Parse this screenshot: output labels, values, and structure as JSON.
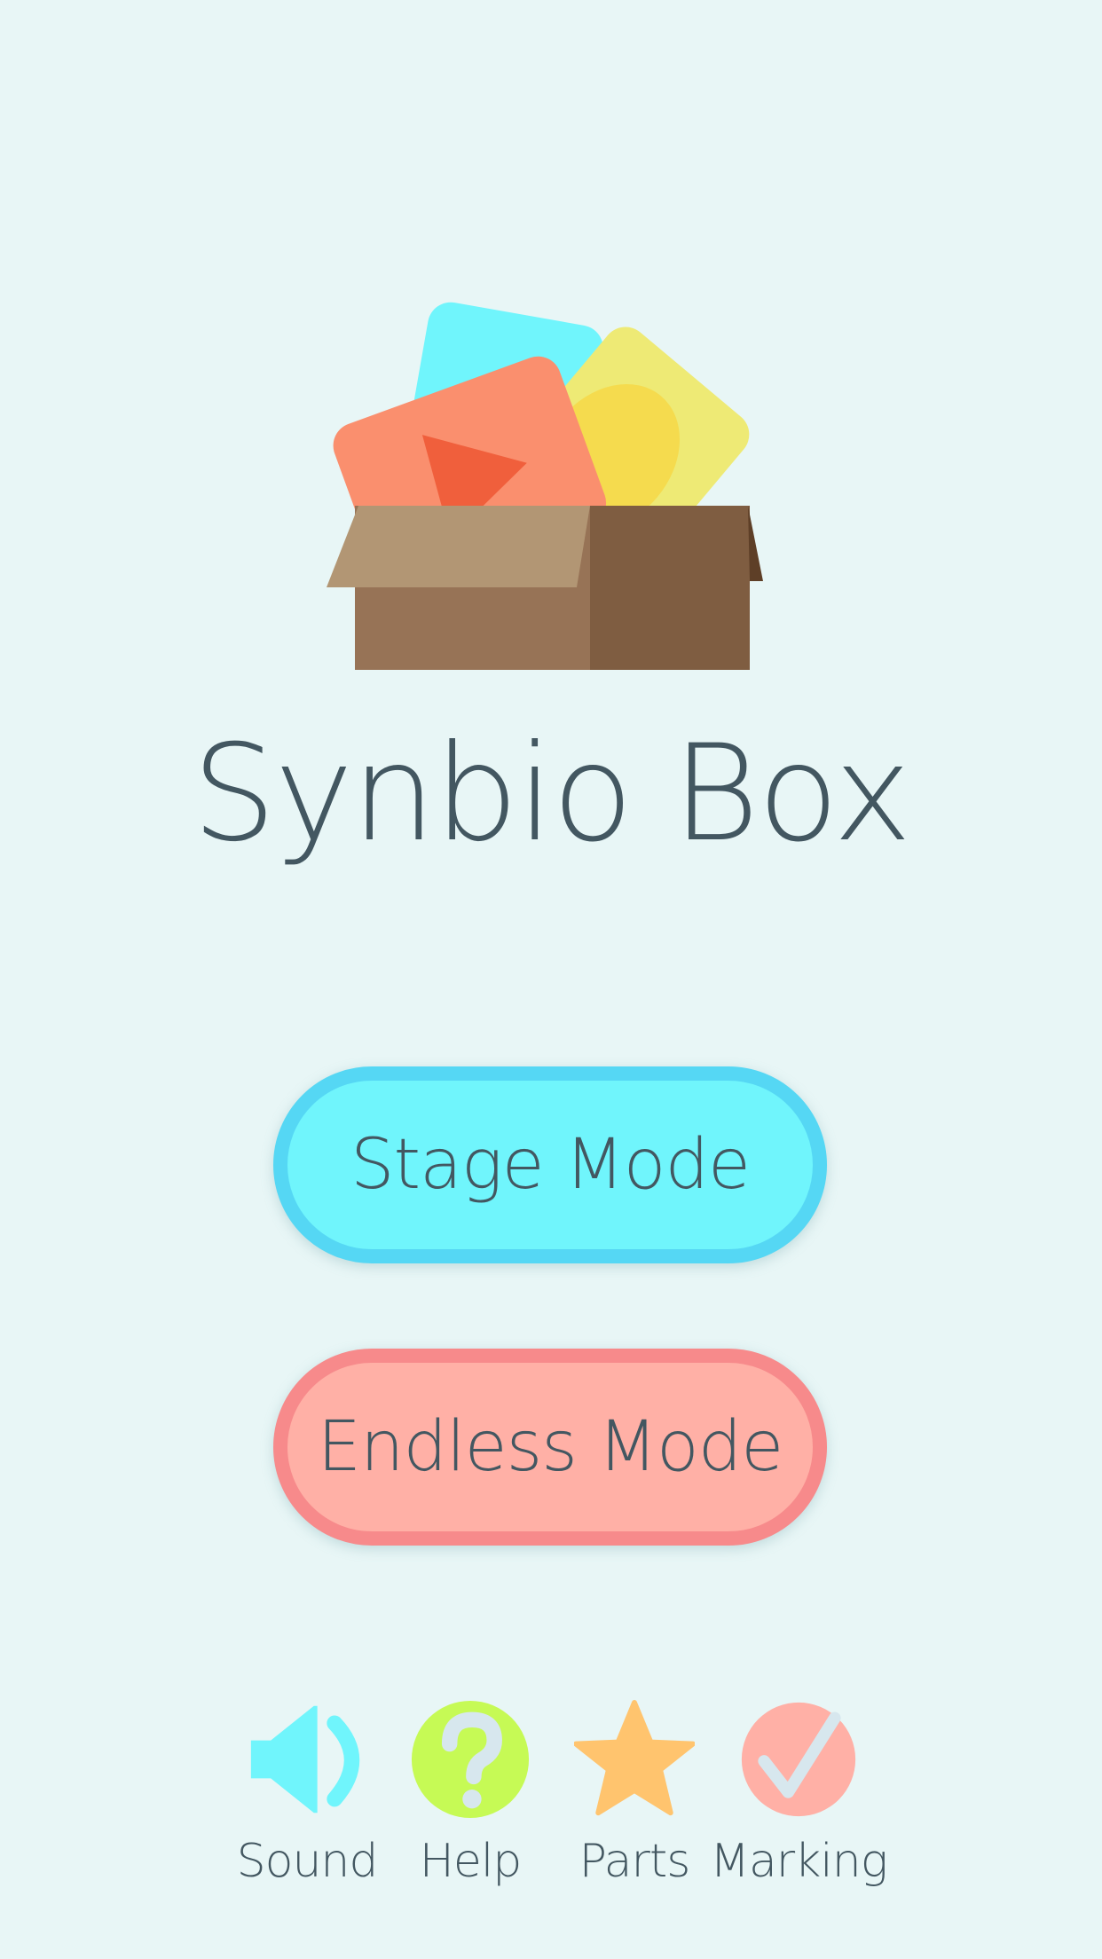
{
  "app": {
    "title": "Synbio Box"
  },
  "buttons": {
    "stage_mode": "Stage Mode",
    "endless_mode": "Endless Mode"
  },
  "toolbar": [
    {
      "label": "Sound",
      "icon": "speaker-icon"
    },
    {
      "label": "Help",
      "icon": "question-icon"
    },
    {
      "label": "Parts",
      "icon": "star-icon"
    },
    {
      "label": "Marking",
      "icon": "checkmark-icon"
    }
  ],
  "colors": {
    "background": "#e8f6f6",
    "text": "#435761",
    "stage_fill": "#70f5fc",
    "stage_border": "#55d7f4",
    "endless_fill": "#ffb0a6",
    "endless_border": "#f78a8b",
    "sound_icon": "#70f5fc",
    "help_icon": "#c6fa55",
    "parts_icon": "#ffc46e",
    "marking_icon": "#ffb0a6"
  }
}
